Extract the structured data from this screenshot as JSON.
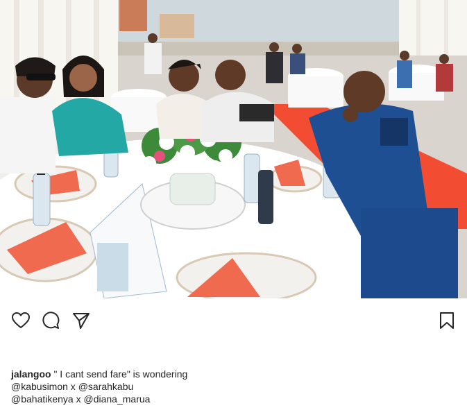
{
  "post": {
    "photo_alt": "Guests seated around a banquet table at an outdoor tent event",
    "actions": {
      "like_icon": "heart-icon",
      "comment_icon": "comment-icon",
      "share_icon": "send-icon",
      "save_icon": "bookmark-icon"
    },
    "caption": {
      "username": "jalangoo",
      "text": " \" I cant send fare\" is wondering",
      "line2": {
        "mention1": "@kabusimon",
        "separator": " x ",
        "mention2": "@sarahkabu"
      },
      "line3": {
        "mention1": "@bahatikenya",
        "separator": " x ",
        "mention2": "@diana_marua"
      }
    }
  }
}
